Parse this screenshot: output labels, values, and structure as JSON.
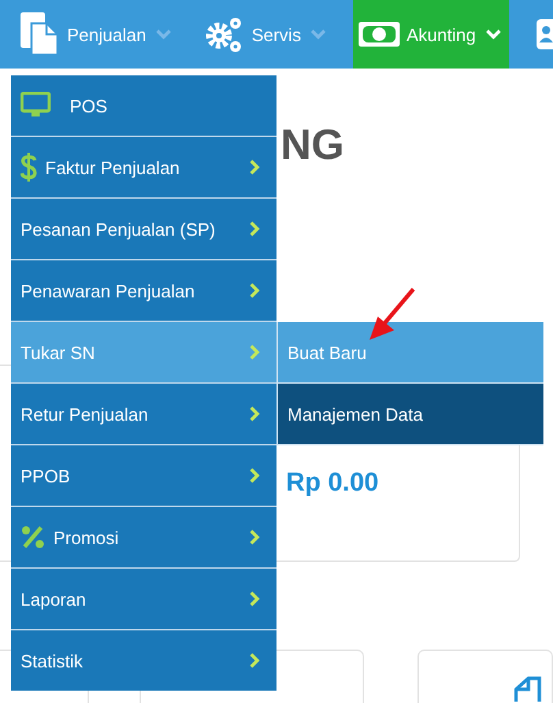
{
  "nav": [
    {
      "label": "Penjualan",
      "selected": false
    },
    {
      "label": "Servis",
      "selected": false
    },
    {
      "label": "Akunting",
      "selected": true
    },
    {
      "selected": false
    }
  ],
  "heading_fragment": "NG",
  "card": {
    "amount": "Rp 0.00"
  },
  "menu": [
    {
      "label": "POS",
      "has_submenu": false,
      "selected": false
    },
    {
      "label": "Faktur Penjualan",
      "has_submenu": true,
      "selected": false
    },
    {
      "label": "Pesanan Penjualan (SP)",
      "has_submenu": true,
      "selected": false
    },
    {
      "label": "Penawaran Penjualan",
      "has_submenu": true,
      "selected": false
    },
    {
      "label": "Tukar SN",
      "has_submenu": true,
      "selected": true
    },
    {
      "label": "Retur Penjualan",
      "has_submenu": true,
      "selected": false
    },
    {
      "label": "PPOB",
      "has_submenu": true,
      "selected": false
    },
    {
      "label": "Promosi",
      "has_submenu": true,
      "selected": false
    },
    {
      "label": "Laporan",
      "has_submenu": true,
      "selected": false
    },
    {
      "label": "Statistik",
      "has_submenu": true,
      "selected": false
    }
  ],
  "submenu": [
    {
      "label": "Buat Baru",
      "selected": true
    },
    {
      "label": "Manajemen Data",
      "selected": false
    }
  ]
}
